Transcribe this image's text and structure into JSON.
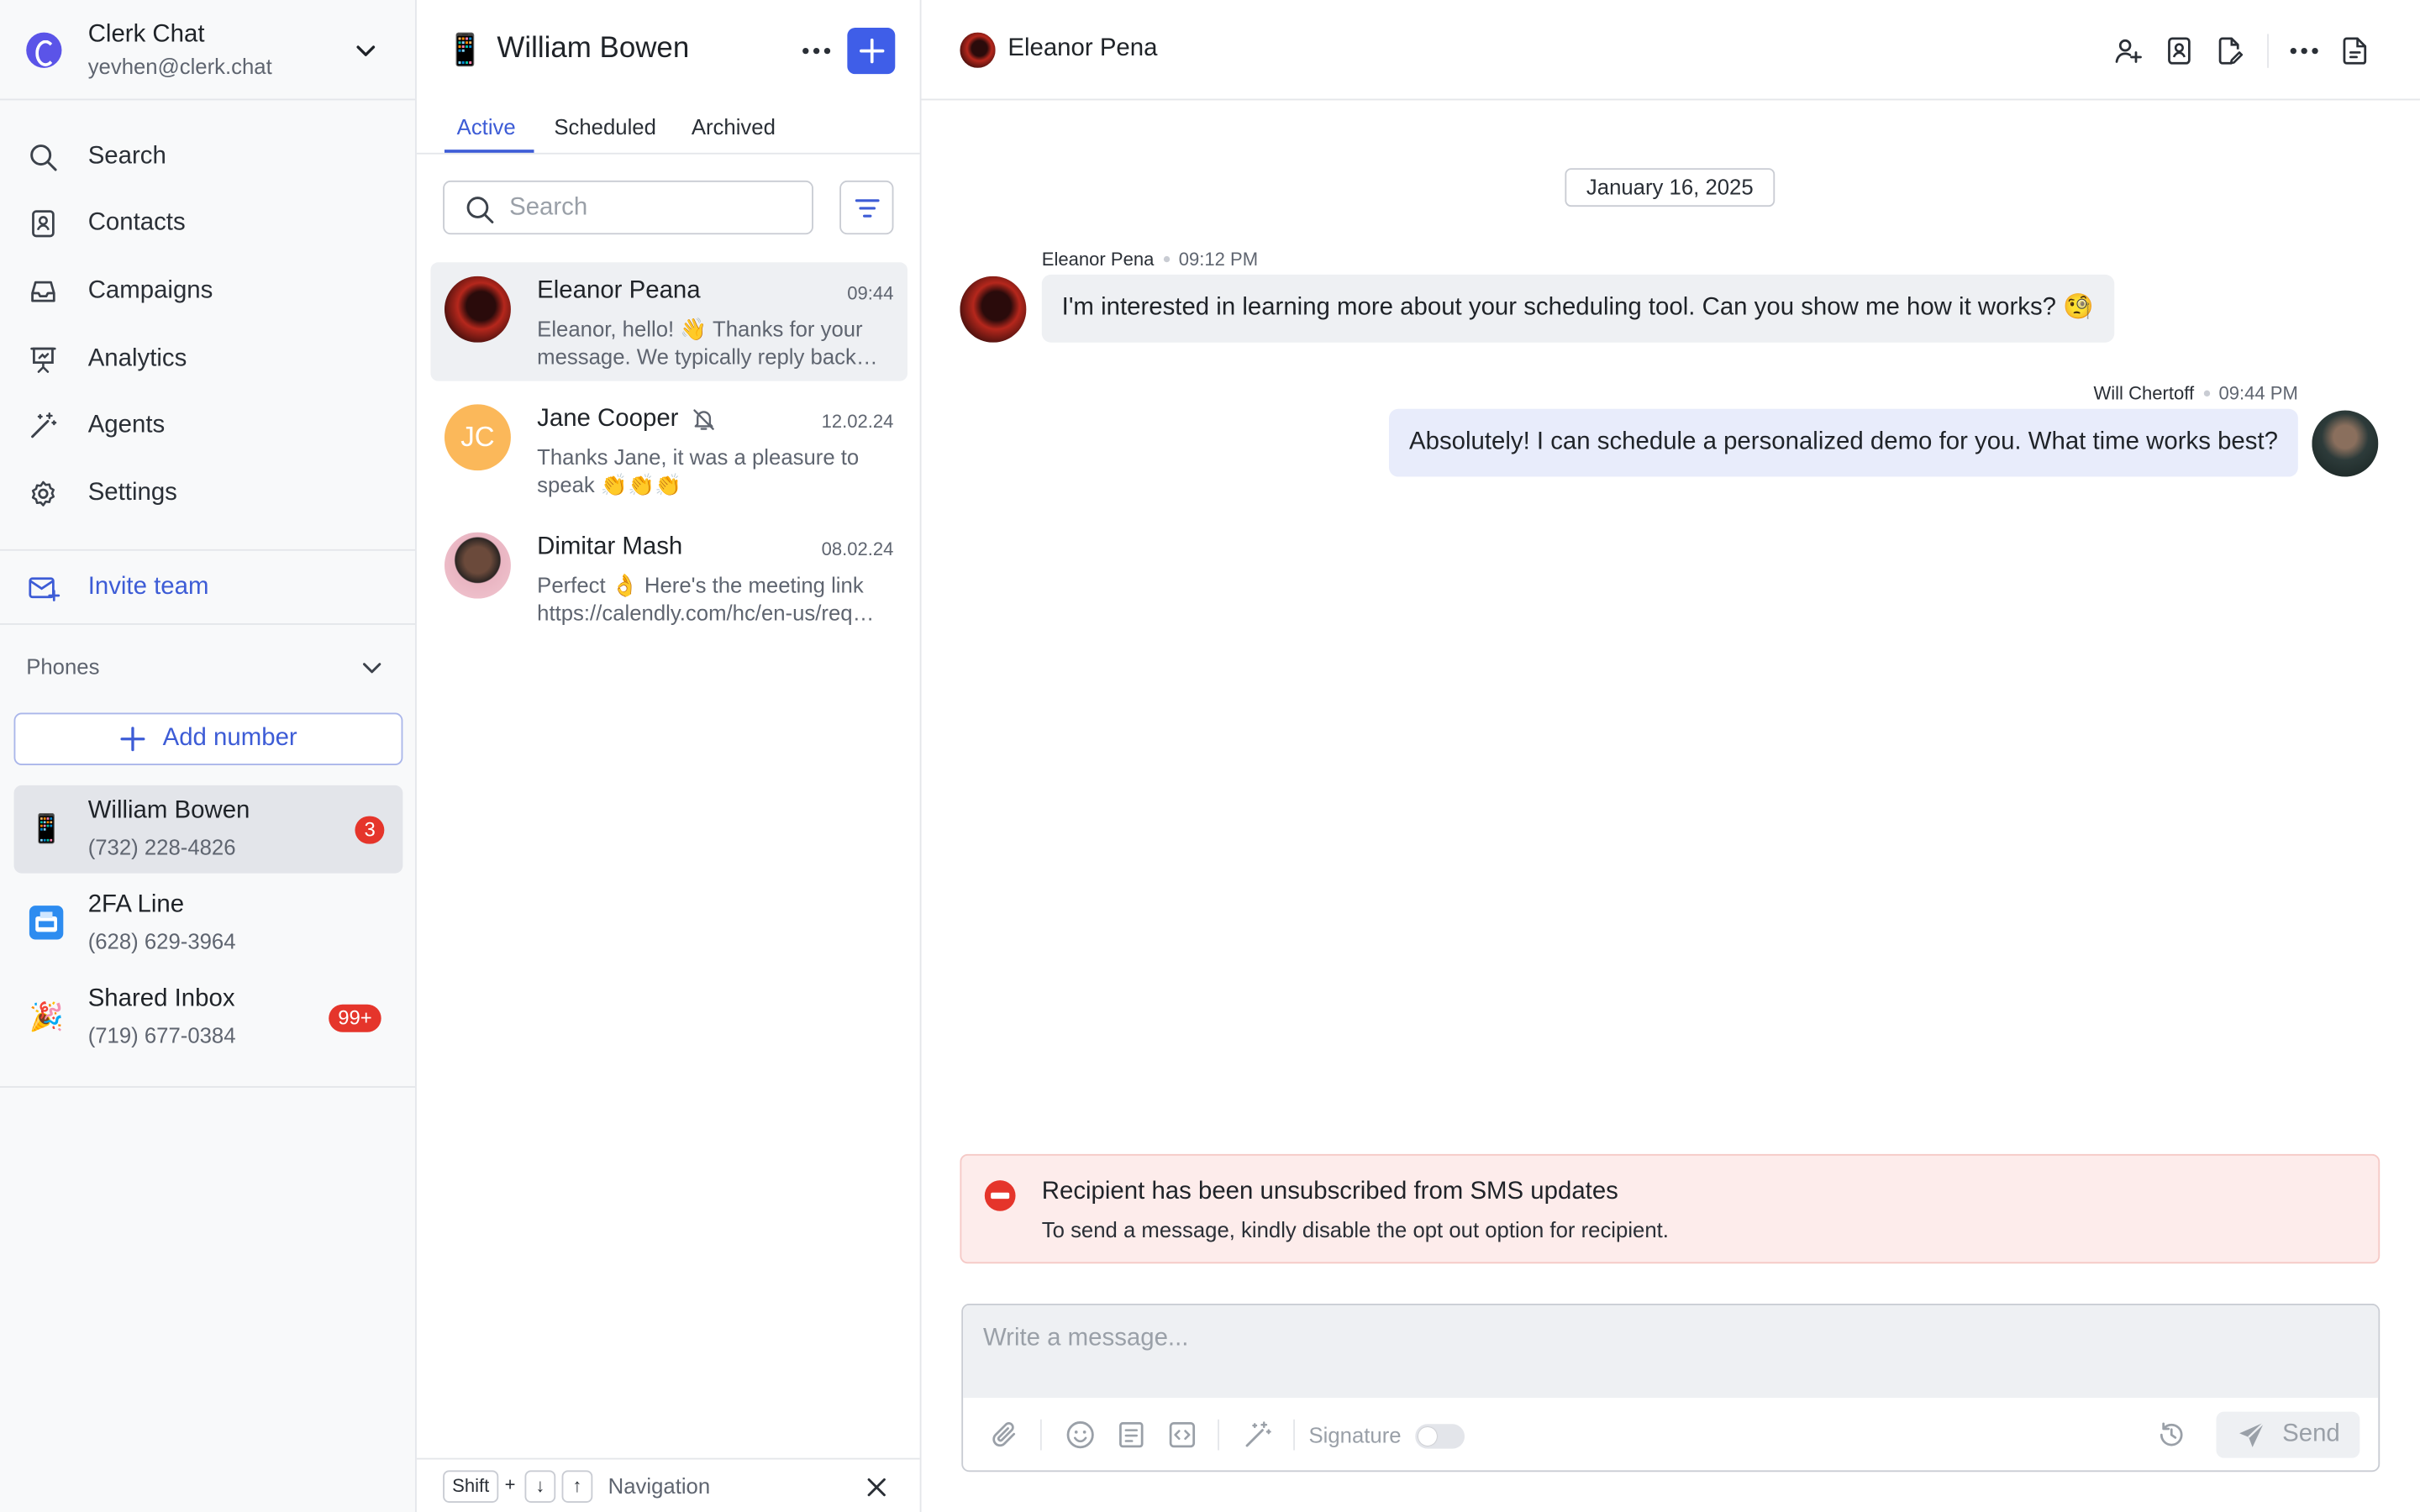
{
  "workspace": {
    "name": "Clerk Chat",
    "email": "yevhen@clerk.chat"
  },
  "nav": [
    {
      "label": "Search",
      "icon": "search-icon"
    },
    {
      "label": "Contacts",
      "icon": "contacts-icon"
    },
    {
      "label": "Campaigns",
      "icon": "inbox-icon"
    },
    {
      "label": "Analytics",
      "icon": "presentation-icon"
    },
    {
      "label": "Agents",
      "icon": "magic-wand-icon"
    },
    {
      "label": "Settings",
      "icon": "gear-icon"
    }
  ],
  "invite": {
    "label": "Invite team"
  },
  "phones": {
    "header": "Phones",
    "add_label": "Add number",
    "items": [
      {
        "name": "William Bowen",
        "number": "(732) 228-4826",
        "badge": "3",
        "emoji": "📱"
      },
      {
        "name": "2FA Line",
        "number": "(628) 629-3964",
        "badge": "",
        "emoji": "📠"
      },
      {
        "name": "Shared Inbox",
        "number": "(719) 677-0384",
        "badge": "99+",
        "emoji": "🎉"
      }
    ]
  },
  "conversations": {
    "title": "William Bowen",
    "title_emoji": "📱",
    "tabs": [
      "Active",
      "Scheduled",
      "Archived"
    ],
    "search_placeholder": "Search",
    "items": [
      {
        "name": "Eleanor Peana",
        "time": "09:44",
        "preview": "Eleanor, hello! 👋 Thanks for your message. We typically reply back…"
      },
      {
        "name": "Jane Cooper",
        "time": "12.02.24",
        "preview": "Thanks Jane, it was a pleasure to speak 👏👏👏",
        "initials": "JC"
      },
      {
        "name": "Dimitar Mash",
        "time": "08.02.24",
        "preview": "Perfect 👌 Here's the meeting link https://calendly.com/hc/en-us/req…"
      }
    ]
  },
  "keyboard_hint": {
    "key1": "Shift",
    "plus": "+",
    "down": "↓",
    "up": "↑",
    "label": "Navigation"
  },
  "chat": {
    "contact_name": "Eleanor Pena",
    "date": "January 16, 2025",
    "messages": [
      {
        "sender": "Eleanor Pena",
        "time": "09:12 PM",
        "text": "I'm interested in learning more about your scheduling tool. Can you show me how it works? 🧐",
        "direction": "in"
      },
      {
        "sender": "Will Chertoff",
        "time": "09:44 PM",
        "text": "Absolutely! I can schedule a personalized demo for you. What time works best?",
        "direction": "out"
      }
    ],
    "alert": {
      "title": "Recipient has been unsubscribed from SMS updates",
      "body": "To send a message, kindly disable the opt out option for recipient."
    },
    "composer": {
      "placeholder": "Write a message...",
      "signature_label": "Signature",
      "send_label": "Send"
    }
  },
  "colors": {
    "accent": "#3f5ee8",
    "badge": "#e5352b",
    "alert_bg": "#fdeceb"
  }
}
